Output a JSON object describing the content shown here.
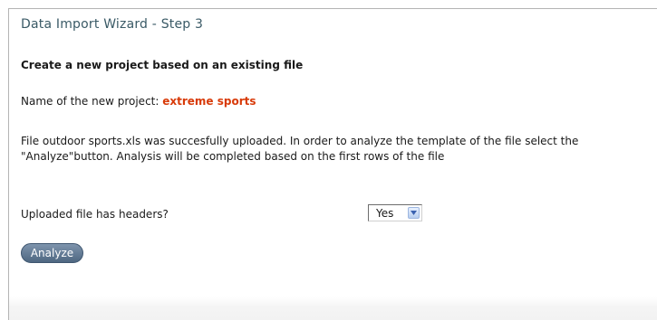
{
  "wizard": {
    "title": "Data Import Wizard - Step 3",
    "subtitle": "Create a new project based on an existing file"
  },
  "project": {
    "label": "Name of the new project: ",
    "name": "extreme sports"
  },
  "upload": {
    "message_line1": "File outdoor sports.xls was succesfully uploaded. In order to analyze the template of the file select the",
    "message_line2": "\"Analyze\"button. Analysis will be completed based on the first rows of the file"
  },
  "headers_field": {
    "label": "Uploaded file has headers?",
    "selected": "Yes",
    "icon": "chevron-down-icon"
  },
  "actions": {
    "analyze_label": "Analyze"
  },
  "colors": {
    "title": "#3a5a66",
    "project_name": "#d83a08",
    "button": "#5a728c"
  }
}
